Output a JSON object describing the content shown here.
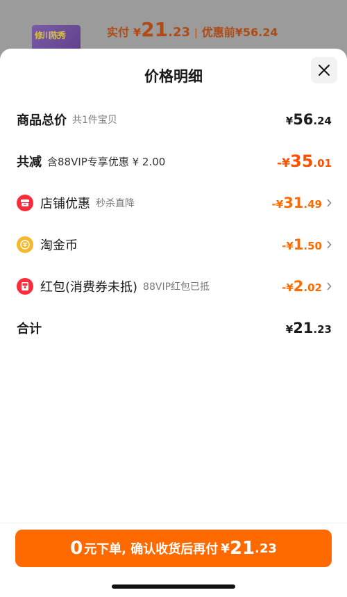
{
  "background": {
    "thumb_text": "修川陈秀",
    "paid_label": "实付",
    "paid_currency": "¥",
    "paid_int": "21",
    "paid_dec": ".23",
    "separator": "|",
    "pre_discount": "优惠前",
    "pre_price": "¥56.24"
  },
  "sheet": {
    "title": "价格明细",
    "rows": {
      "total": {
        "label": "商品总价",
        "sub": "共1件宝贝",
        "cur": "¥",
        "int": "56",
        "dec": ".24"
      },
      "reduce": {
        "label": "共减",
        "sub": "含88VIP专享优惠 ¥ 2.00",
        "cur": "-¥",
        "int": "35",
        "dec": ".01"
      },
      "store": {
        "label": "店铺优惠",
        "sub": "秒杀直降",
        "cur": "-¥",
        "int": "31",
        "dec": ".49"
      },
      "coin": {
        "label": "淘金币",
        "cur": "-¥",
        "int": "1",
        "dec": ".50"
      },
      "redpack": {
        "label": "红包(消费券未抵)",
        "sub": "88VIP红包已抵",
        "cur": "-¥",
        "int": "2",
        "dec": ".02"
      },
      "sum": {
        "label": "合计",
        "cur": "¥",
        "int": "21",
        "dec": ".23"
      }
    },
    "cta": {
      "zero": "0",
      "text": "元下单, 确认收货后再付",
      "cur": "¥",
      "int": "21",
      "dec": ".23"
    },
    "icons": {
      "store": "store-icon",
      "coin": "coin-icon",
      "redpack": "red-packet-icon",
      "close": "close-icon",
      "chevron": "chevron-right-icon"
    },
    "colors": {
      "accent": "#ff6a00",
      "discount": "#ff5000",
      "store_icon_bg": "#ff2a3a",
      "coin_icon_bg": "#f5b72e"
    }
  }
}
